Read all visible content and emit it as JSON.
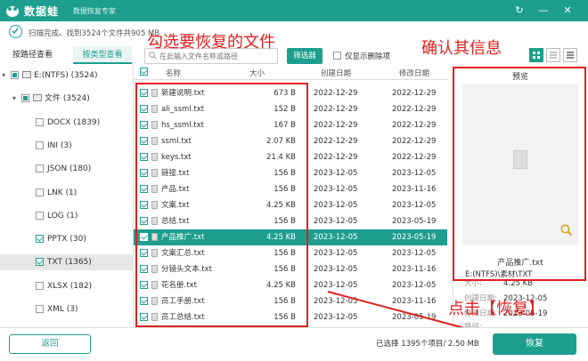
{
  "app": {
    "name": "数据蛙",
    "subtitle": "数据恢复专家",
    "window_controls": [
      "↻",
      "—",
      "✕"
    ]
  },
  "scan": {
    "status": "扫描完成。找到3524个文件共905 MB"
  },
  "tabs": [
    {
      "label": "按路径查看"
    },
    {
      "label": "按类型查看",
      "active": true
    }
  ],
  "toolbar": {
    "search_placeholder": "在此输入文件名称或路径",
    "filter_label": "筛选器",
    "only_deleted_label": "仅显示删除项"
  },
  "tree": [
    {
      "label": "E:(NTFS) (3524)",
      "indent": 0,
      "check": "partial",
      "expand": "▾",
      "icon": "drive-icon"
    },
    {
      "label": "文件 (3524)",
      "indent": 1,
      "check": "partial",
      "expand": "▾",
      "icon": "folder-icon"
    },
    {
      "label": "DOCX (1839)",
      "indent": 2,
      "check": "none"
    },
    {
      "label": "INI (3)",
      "indent": 2,
      "check": "none"
    },
    {
      "label": "JSON (180)",
      "indent": 2,
      "check": "none"
    },
    {
      "label": "LNK (1)",
      "indent": 2,
      "check": "none"
    },
    {
      "label": "LOG (1)",
      "indent": 2,
      "check": "none"
    },
    {
      "label": "PPTX (30)",
      "indent": 2,
      "check": "checked"
    },
    {
      "label": "TXT (1365)",
      "indent": 2,
      "check": "checked",
      "selected": true
    },
    {
      "label": "XLSX (182)",
      "indent": 2,
      "check": "none"
    },
    {
      "label": "XML (3)",
      "indent": 2,
      "check": "none"
    },
    {
      "label": "ZIP (3)",
      "indent": 2,
      "check": "none"
    }
  ],
  "columns": {
    "name": "名称",
    "size": "大小",
    "created": "创建日期",
    "modified": "修改日期"
  },
  "files": [
    {
      "name": "新建说明.txt",
      "size": "673 B",
      "created": "2022-12-29",
      "modified": "2022-12-29"
    },
    {
      "name": "ali_ssml.txt",
      "size": "152 B",
      "created": "2022-12-29",
      "modified": "2022-12-29"
    },
    {
      "name": "hs_ssml.txt",
      "size": "167 B",
      "created": "2022-12-29",
      "modified": "2022-12-29"
    },
    {
      "name": "ssml.txt",
      "size": "2.07 KB",
      "created": "2022-12-29",
      "modified": "2022-12-29"
    },
    {
      "name": "keys.txt",
      "size": "21.4 KB",
      "created": "2022-12-29",
      "modified": "2022-12-29"
    },
    {
      "name": "链接.txt",
      "size": "156 B",
      "created": "2023-12-05",
      "modified": "2023-12-05"
    },
    {
      "name": "产品.txt",
      "size": "156 B",
      "created": "2023-12-05",
      "modified": "2023-11-16"
    },
    {
      "name": "文案.txt",
      "size": "4.25 KB",
      "created": "2023-12-05",
      "modified": "2023-12-05"
    },
    {
      "name": "总结.txt",
      "size": "156 B",
      "created": "2023-12-05",
      "modified": "2023-05-19"
    },
    {
      "name": "产品推广.txt",
      "size": "4.25 KB",
      "created": "2023-12-05",
      "modified": "2023-05-19",
      "selected": true
    },
    {
      "name": "文案汇总.txt",
      "size": "156 B",
      "created": "2023-12-05",
      "modified": "2023-12-05"
    },
    {
      "name": "分镜头文本.txt",
      "size": "156 B",
      "created": "2023-12-05",
      "modified": "2023-11-16"
    },
    {
      "name": "花名册.txt",
      "size": "4.25 KB",
      "created": "2023-12-05",
      "modified": "2023-12-05"
    },
    {
      "name": "员工手册.txt",
      "size": "156 B",
      "created": "2023-12-05",
      "modified": "2023-11-16"
    },
    {
      "name": "员工总结.txt",
      "size": "156 B",
      "created": "2023-12-05",
      "modified": "2023-05-19"
    }
  ],
  "preview": {
    "title": "预览",
    "filename": "产品推广.txt",
    "size_label": "大小:",
    "size": "4.25 KB",
    "created_label": "创建日期:",
    "created": "2023-12-05",
    "modified_label": "修改日期:",
    "modified": "2023-05-19",
    "path_label": "路径:",
    "path": "E:(NTFS)\\素材\\TXT"
  },
  "annotations": {
    "select_files": "勾选要恢复的文件",
    "confirm_info": "确认其信息",
    "click_recover": "点击【恢复】"
  },
  "footer": {
    "back_label": "返回",
    "selection_status": "已选择 1395个项目/ 2.50 MB",
    "recover_label": "恢复"
  },
  "colors": {
    "accent": "#1e9f8d",
    "annotation": "#e02020"
  }
}
